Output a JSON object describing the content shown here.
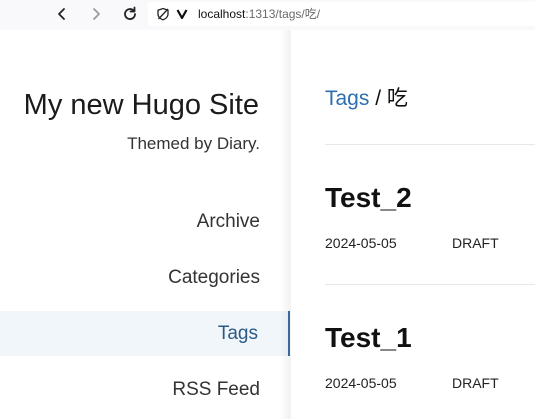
{
  "browser": {
    "url_host": "localhost",
    "url_rest": ":1313/tags/吃/",
    "icons": [
      "back-icon",
      "forward-icon",
      "reload-icon",
      "tracking-protection-icon",
      "site-identity-icon"
    ]
  },
  "sidebar": {
    "title": "My new Hugo Site",
    "subtitle": "Themed by Diary.",
    "items": [
      {
        "label": "Archive",
        "active": false
      },
      {
        "label": "Categories",
        "active": false
      },
      {
        "label": "Tags",
        "active": true
      },
      {
        "label": "RSS Feed",
        "active": false
      }
    ]
  },
  "main": {
    "breadcrumb": {
      "link": "Tags",
      "separator": " / ",
      "current": "吃"
    },
    "posts": [
      {
        "title": "Test_2",
        "date": "2024-05-05",
        "status": "DRAFT"
      },
      {
        "title": "Test_1",
        "date": "2024-05-05",
        "status": "DRAFT"
      }
    ]
  },
  "colors": {
    "accent": "#2e6fb0",
    "active_bg": "#f1f6fb",
    "active_text": "#2b5a87"
  }
}
